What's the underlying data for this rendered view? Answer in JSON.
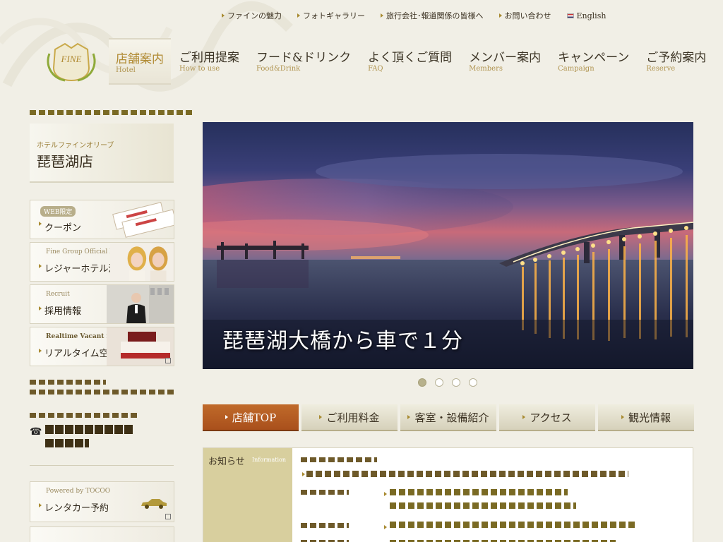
{
  "top_links": [
    {
      "label": "ファインの魅力"
    },
    {
      "label": "フォトギャラリー"
    },
    {
      "label": "旅行会社･報道関係の皆様へ"
    },
    {
      "label": "お問い合わせ"
    },
    {
      "label": "English"
    }
  ],
  "logo": {
    "text": "FINE"
  },
  "main_nav": [
    {
      "jp": "店舗案内",
      "en": "Hotel"
    },
    {
      "jp": "ご利用提案",
      "en": "How to use"
    },
    {
      "jp": "フード&ドリンク",
      "en": "Food&Drink"
    },
    {
      "jp": "よく頂くご質問",
      "en": "FAQ"
    },
    {
      "jp": "メンバー案内",
      "en": "Members"
    },
    {
      "jp": "キャンペーン",
      "en": "Campaign"
    },
    {
      "jp": "ご予約案内",
      "en": "Reserve"
    }
  ],
  "store": {
    "brand": "ホテルファインオリーブ",
    "name": "琵琶湖店"
  },
  "sidebar_banners": [
    {
      "small": "WEB限定",
      "label": "クーポン"
    },
    {
      "small": "Fine Group Official Blog",
      "label": "レジャーホテル活用法"
    },
    {
      "small": "Recruit",
      "label": "採用情報"
    },
    {
      "small": "Realtime Vacant room",
      "label": "リアルタイム空室状況"
    }
  ],
  "rental_banner": {
    "small": "Powered by TOCOO",
    "label": "レンタカー予約"
  },
  "hero": {
    "caption": "琵琶湖大橋から車で１分"
  },
  "tabs": [
    {
      "label": "店舗TOP"
    },
    {
      "label": "ご利用料金"
    },
    {
      "label": "客室・設備紹介"
    },
    {
      "label": "アクセス"
    },
    {
      "label": "観光情報"
    }
  ],
  "news": {
    "label": "お知らせ",
    "label_en": "Information"
  },
  "colors": {
    "accent": "#a9501c",
    "gold": "#b08a32",
    "bg": "#f1efe6"
  }
}
